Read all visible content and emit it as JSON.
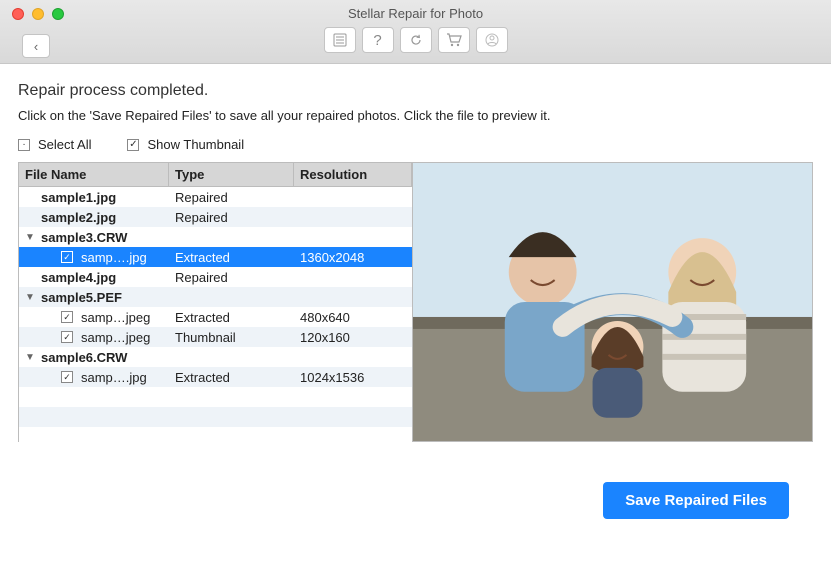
{
  "window": {
    "title": "Stellar Repair for Photo"
  },
  "toolbar": {
    "back": "‹",
    "buttons": [
      "list-icon",
      "help-icon",
      "refresh-icon",
      "cart-icon",
      "user-icon"
    ]
  },
  "heading": "Repair process completed.",
  "subheading": "Click on the 'Save Repaired Files' to save all your repaired photos. Click the file to preview it.",
  "options": {
    "select_all": {
      "label": "Select All",
      "checked": "·"
    },
    "show_thumb": {
      "label": "Show Thumbnail",
      "checked": "✓"
    }
  },
  "table": {
    "headers": {
      "file": "File Name",
      "type": "Type",
      "res": "Resolution"
    },
    "rows": [
      {
        "kind": "file",
        "bold": true,
        "name": "sample1.jpg",
        "type": "Repaired",
        "res": ""
      },
      {
        "kind": "file",
        "bold": true,
        "name": "sample2.jpg",
        "type": "Repaired",
        "res": ""
      },
      {
        "kind": "group",
        "bold": true,
        "name": "sample3.CRW"
      },
      {
        "kind": "child",
        "selected": true,
        "name": "samp….jpg",
        "type": "Extracted",
        "res": "1360x2048"
      },
      {
        "kind": "file",
        "bold": true,
        "name": "sample4.jpg",
        "type": "Repaired",
        "res": ""
      },
      {
        "kind": "group",
        "bold": true,
        "name": "sample5.PEF"
      },
      {
        "kind": "child",
        "name": "samp…jpeg",
        "type": "Extracted",
        "res": "480x640"
      },
      {
        "kind": "child",
        "name": "samp…jpeg",
        "type": "Thumbnail",
        "res": "120x160"
      },
      {
        "kind": "group",
        "bold": true,
        "name": "sample6.CRW"
      },
      {
        "kind": "child",
        "name": "samp….jpg",
        "type": "Extracted",
        "res": "1024x1536"
      },
      {
        "kind": "blank"
      },
      {
        "kind": "blank"
      },
      {
        "kind": "blank"
      }
    ]
  },
  "footer": {
    "save_label": "Save Repaired Files"
  }
}
